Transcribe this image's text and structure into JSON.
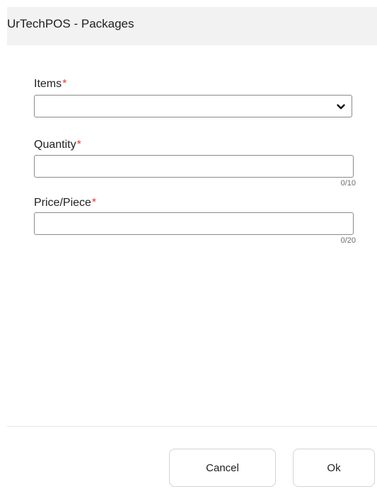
{
  "dialog": {
    "title": "UrTechPOS - Packages"
  },
  "form": {
    "items": {
      "label": "Items",
      "required_marker": "*",
      "value": ""
    },
    "quantity": {
      "label": "Quantity",
      "required_marker": "*",
      "value": "",
      "counter": "0/10"
    },
    "price": {
      "label": "Price/Piece",
      "required_marker": "*",
      "value": "",
      "counter": "0/20"
    }
  },
  "footer": {
    "cancel_label": "Cancel",
    "ok_label": "Ok"
  },
  "colors": {
    "header_bg": "#f2f2f2",
    "required": "#e53935",
    "border": "#8a8a8a"
  },
  "icons": {
    "dropdown": "chevron-down-icon"
  }
}
